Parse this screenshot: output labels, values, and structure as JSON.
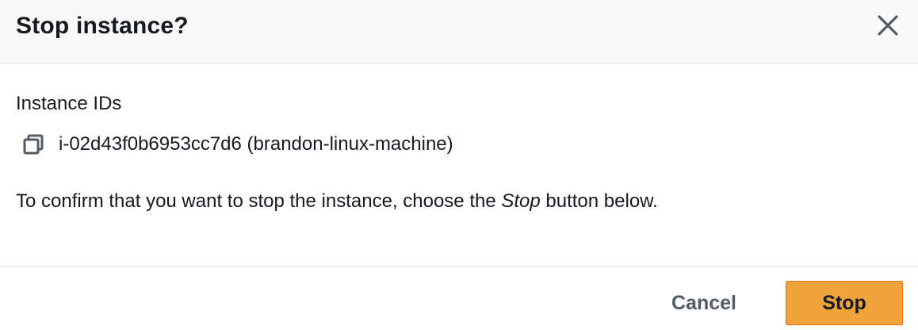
{
  "dialog": {
    "title": "Stop instance?",
    "close_icon": "close-icon"
  },
  "body": {
    "label": "Instance IDs",
    "copy_icon": "copy-icon",
    "instance_id": "i-02d43f0b6953cc7d6 (brandon-linux-machine)",
    "confirm_prefix": "To confirm that you want to stop the instance, choose the ",
    "confirm_emphasis": "Stop",
    "confirm_suffix": " button below."
  },
  "footer": {
    "cancel_label": "Cancel",
    "stop_label": "Stop"
  },
  "colors": {
    "primary_button": "#f0a33a",
    "header_background": "#f9f9f9",
    "text": "#16191f",
    "secondary_text": "#545b64"
  }
}
